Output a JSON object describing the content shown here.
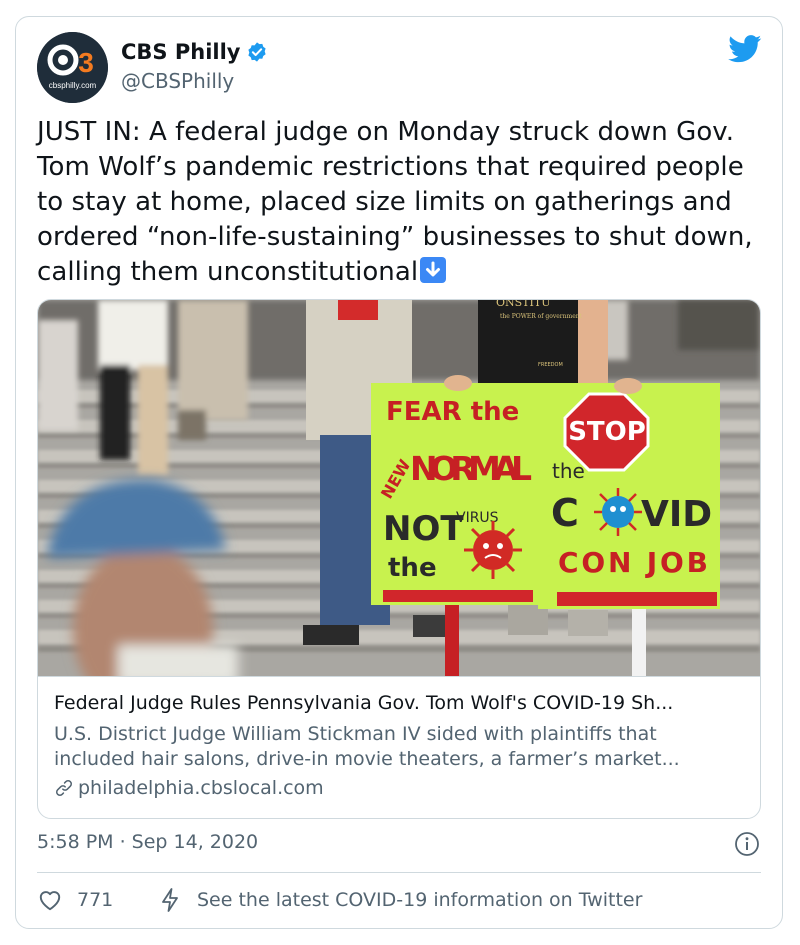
{
  "author": {
    "display_name": "CBS Philly",
    "handle": "@CBSPhilly",
    "avatar_text": "cbsphilly.com",
    "verified": true
  },
  "tweet": {
    "text": "JUST IN: A federal judge on Monday struck down Gov. Tom Wolf’s pandemic restrictions that required people to stay at home, placed size limits on gatherings and ordered “non-life-sustaining” businesses to shut down, calling them unconstitutional",
    "trailing_emoji": "down-arrow-emoji"
  },
  "link_card": {
    "image_signs": {
      "left_sign": [
        "FEAR the",
        "NEW",
        "NORMAL",
        "NOT",
        "the",
        "VIRUS"
      ],
      "right_sign": [
        "STOP",
        "the",
        "C",
        "VID",
        "CON JOB"
      ],
      "shirt_text": [
        "ONSTITU",
        "the POWER of government",
        "FREEDOM"
      ]
    },
    "title": "Federal Judge Rules Pennsylvania Gov. Tom Wolf's COVID-19 Sh...",
    "description_line1": "U.S. District Judge William Stickman IV sided with plaintiffs that",
    "description_line2": "included hair salons, drive-in movie theaters, a farmer’s market...",
    "domain": "philadelphia.cbslocal.com"
  },
  "timestamp": "5:58 PM · Sep 14, 2020",
  "actions": {
    "like_count": "771",
    "covid_info": "See the latest COVID-19 information on Twitter"
  },
  "colors": {
    "twitter_blue": "#1d9bf0",
    "secondary_text": "#536471",
    "border": "#cfd9de",
    "sign_green": "#c8f24e",
    "sign_red": "#d1262b"
  },
  "icons": [
    "twitter-bird-icon",
    "verified-badge-icon",
    "link-icon",
    "info-icon",
    "heart-icon",
    "bolt-icon"
  ]
}
